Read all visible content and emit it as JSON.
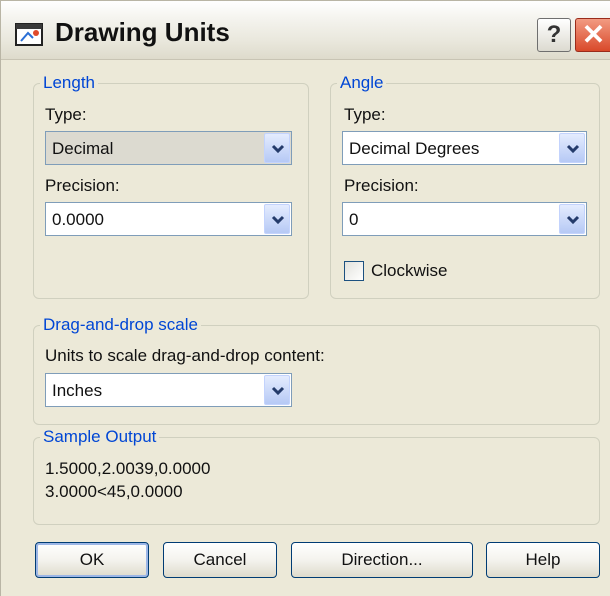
{
  "window": {
    "title": "Drawing Units",
    "help_label": "?",
    "close_label": "✕"
  },
  "length": {
    "legend": "Length",
    "type_label": "Type:",
    "type_value": "Decimal",
    "precision_label": "Precision:",
    "precision_value": "0.0000"
  },
  "angle": {
    "legend": "Angle",
    "type_label": "Type:",
    "type_value": "Decimal Degrees",
    "precision_label": "Precision:",
    "precision_value": "0",
    "clockwise_label": "Clockwise",
    "clockwise_checked": false
  },
  "dragdrop": {
    "legend": "Drag-and-drop scale",
    "units_label": "Units to scale drag-and-drop content:",
    "units_value": "Inches"
  },
  "sample": {
    "legend": "Sample Output",
    "line1": "1.5000,2.0039,0.0000",
    "line2": "3.0000<45,0.0000"
  },
  "buttons": {
    "ok": "OK",
    "cancel": "Cancel",
    "direction": "Direction...",
    "help": "Help"
  },
  "colors": {
    "group_legend": "#0046d5",
    "dialog_bg": "#ece9d8",
    "close_red": "#d9492a"
  }
}
